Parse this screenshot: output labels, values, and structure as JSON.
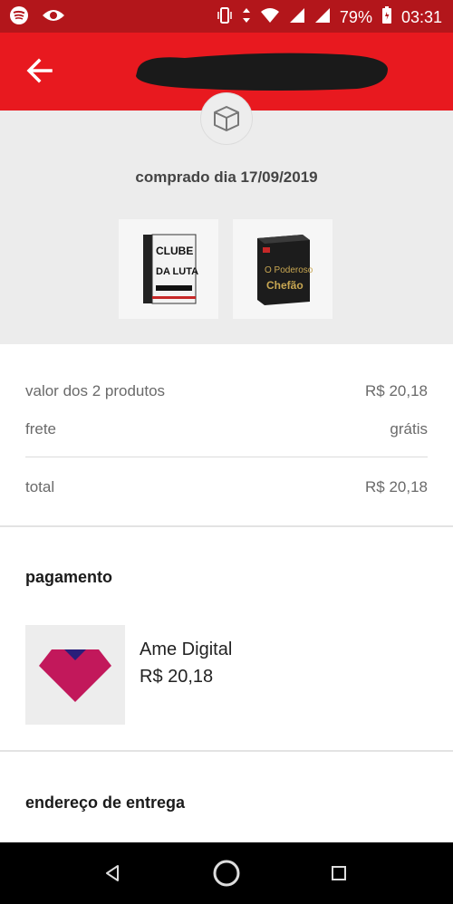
{
  "status_bar": {
    "battery": "79%",
    "time": "03:31"
  },
  "summary": {
    "purchase_date": "comprado dia 17/09/2019",
    "products": [
      {
        "cover_text_1": "CLUBE",
        "cover_text_2": "DA LUTA"
      },
      {
        "cover_text_1": "O Poderoso",
        "cover_text_2": "Chefão"
      }
    ]
  },
  "totals": {
    "products_label": "valor dos 2 produtos",
    "products_value": "R$ 20,18",
    "shipping_label": "frete",
    "shipping_value": "grátis",
    "total_label": "total",
    "total_value": "R$ 20,18"
  },
  "payment": {
    "section_title": "pagamento",
    "method_name": "Ame Digital",
    "amount": "R$ 20,18"
  },
  "delivery": {
    "section_title": "endereço de entrega"
  },
  "colors": {
    "status_bar": "#b3161b",
    "app_bar": "#e8191f",
    "summary_bg": "#ececec",
    "ame_logo": "#c2185b",
    "ame_logo_top": "#2a1e7a"
  }
}
